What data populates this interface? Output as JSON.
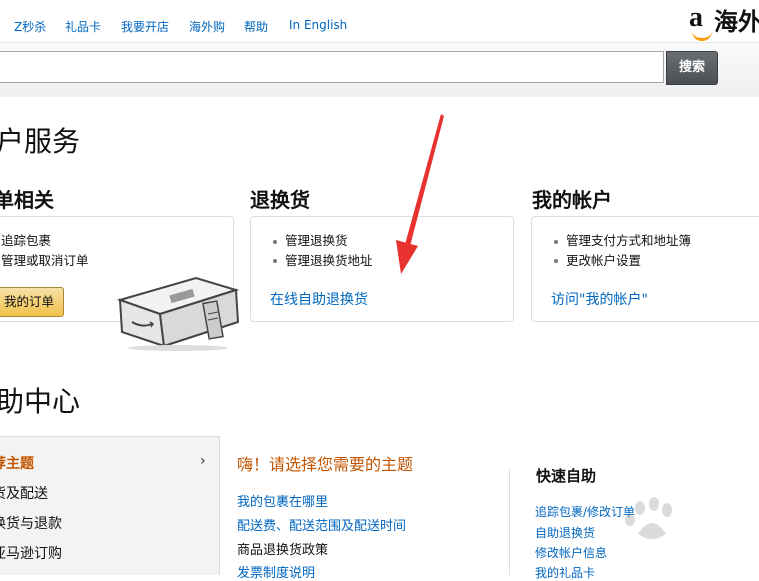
{
  "nav": {
    "links": [
      "Z秒杀",
      "礼品卡",
      "我要开店",
      "海外购",
      "帮助",
      "In English"
    ],
    "logo_letter": "a",
    "logo_text": "海外"
  },
  "search": {
    "button_label": "搜索",
    "value": ""
  },
  "page_title": "户服务",
  "sections": [
    {
      "title": "单相关",
      "items": [
        "追踪包裹",
        "管理或取消订单"
      ],
      "button_label": "我的订单"
    },
    {
      "title": "退换货",
      "items": [
        "管理退换货",
        "管理退换货地址"
      ],
      "link": "在线自助退换货"
    },
    {
      "title": "我的帐户",
      "items": [
        "管理支付方式和地址簿",
        "更改帐户设置"
      ],
      "link": "访问\"我的帐户\""
    }
  ],
  "help_title": "助中心",
  "help_sidebar": {
    "items": [
      "荐主题",
      "货及配送",
      "换货与退款",
      "亚马逊订购"
    ]
  },
  "topics": {
    "heading": "嗨！请选择您需要的主题",
    "links": [
      "我的包裹在哪里",
      "配送费、配送范围及配送时间",
      "商品退换货政策",
      "发票制度说明"
    ]
  },
  "quick_help": {
    "title": "快速自助",
    "links": [
      "追踪包裹/修改订单",
      "自助退换货",
      "修改帐户信息",
      "我的礼品卡"
    ]
  },
  "colors": {
    "link": "#0066c0",
    "accent": "#c45500",
    "annotation_arrow": "#e8322f",
    "button_yellow": "#f0c14b"
  }
}
